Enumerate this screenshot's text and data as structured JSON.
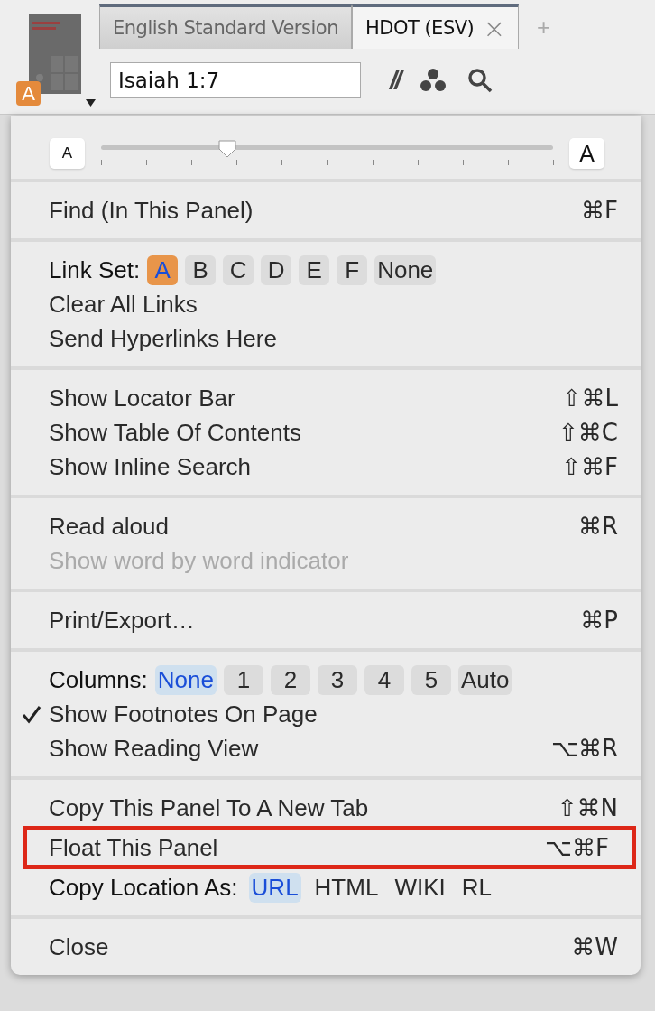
{
  "tabs": [
    {
      "label": "English Standard Version",
      "selected": false
    },
    {
      "label": "HDOT (ESV)",
      "selected": true,
      "close": "×"
    }
  ],
  "add_tab": "+",
  "book": {
    "link_badge": "A"
  },
  "reference_field": {
    "value": "Isaiah 1:7"
  },
  "toolbar": {
    "parallel": "//"
  },
  "font_size": {
    "small": "A",
    "large": "A",
    "level": 0.28
  },
  "menu": [
    {
      "items": [
        {
          "kind": "item",
          "label": "Find (In This Panel)",
          "shortcut": "⌘F",
          "checked": false,
          "disabled": false
        }
      ]
    },
    {
      "items": [
        {
          "kind": "link_set",
          "label": "Link Set:",
          "options": [
            {
              "label": "A",
              "selected": true
            },
            {
              "label": "B",
              "selected": false
            },
            {
              "label": "C",
              "selected": false
            },
            {
              "label": "D",
              "selected": false
            },
            {
              "label": "E",
              "selected": false
            },
            {
              "label": "F",
              "selected": false
            },
            {
              "label": "None",
              "selected": false
            }
          ]
        },
        {
          "kind": "item",
          "label": "Clear All Links",
          "checked": false,
          "disabled": false
        },
        {
          "kind": "item",
          "label": "Send Hyperlinks Here",
          "checked": false,
          "disabled": false
        }
      ]
    },
    {
      "items": [
        {
          "kind": "item",
          "label": "Show Locator Bar",
          "shortcut": "⇧⌘L",
          "checked": false,
          "disabled": false
        },
        {
          "kind": "item",
          "label": "Show Table Of Contents",
          "shortcut": "⇧⌘C",
          "checked": false,
          "disabled": false
        },
        {
          "kind": "item",
          "label": "Show Inline Search",
          "shortcut": "⇧⌘F",
          "checked": false,
          "disabled": false
        }
      ]
    },
    {
      "items": [
        {
          "kind": "item",
          "label": "Read aloud",
          "shortcut": "⌘R",
          "checked": false,
          "disabled": false
        },
        {
          "kind": "item",
          "label": "Show word by word indicator",
          "checked": false,
          "disabled": true
        }
      ]
    },
    {
      "items": [
        {
          "kind": "item",
          "label": "Print/Export…",
          "shortcut": "⌘P",
          "checked": false,
          "disabled": false
        }
      ]
    },
    {
      "items": [
        {
          "kind": "columns",
          "label": "Columns:",
          "options": [
            {
              "label": "None",
              "selected": true
            },
            {
              "label": "1",
              "selected": false
            },
            {
              "label": "2",
              "selected": false
            },
            {
              "label": "3",
              "selected": false
            },
            {
              "label": "4",
              "selected": false
            },
            {
              "label": "5",
              "selected": false
            },
            {
              "label": "Auto",
              "selected": false
            }
          ]
        },
        {
          "kind": "item",
          "label": "Show Footnotes On Page",
          "checked": true,
          "disabled": false
        },
        {
          "kind": "item",
          "label": "Show Reading View",
          "shortcut": "⌥⌘R",
          "checked": false,
          "disabled": false
        }
      ]
    },
    {
      "items": [
        {
          "kind": "item",
          "label": "Copy This Panel To A New Tab",
          "shortcut": "⇧⌘N",
          "checked": false,
          "disabled": false
        },
        {
          "kind": "item",
          "label": "Float This Panel",
          "shortcut": "⌥⌘F",
          "checked": false,
          "disabled": false,
          "highlighted": true
        },
        {
          "kind": "copy_as",
          "label": "Copy Location As:",
          "options": [
            {
              "label": "URL",
              "selected": true
            },
            {
              "label": "HTML",
              "selected": false
            },
            {
              "label": "WIKI",
              "selected": false
            },
            {
              "label": "RL",
              "selected": false
            }
          ]
        }
      ]
    },
    {
      "items": [
        {
          "kind": "item",
          "label": "Close",
          "shortcut": "⌘W",
          "checked": false,
          "disabled": false
        }
      ]
    }
  ]
}
